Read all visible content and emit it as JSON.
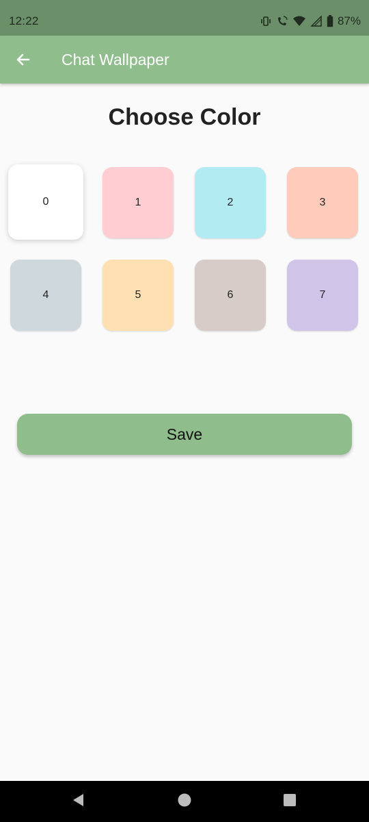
{
  "status_bar": {
    "time": "12:22",
    "battery": "87%",
    "icons": [
      "vibrate-icon",
      "wifi-call-icon",
      "wifi-icon",
      "signal-icon",
      "battery-icon"
    ]
  },
  "app_bar": {
    "title": "Chat Wallpaper",
    "back_icon": "arrow-left-icon",
    "color": "#8fbd8c"
  },
  "page": {
    "title": "Choose Color"
  },
  "swatches": [
    {
      "label": "0",
      "color": "#ffffff",
      "selected": true
    },
    {
      "label": "1",
      "color": "#ffcdd2"
    },
    {
      "label": "2",
      "color": "#b2ebf2"
    },
    {
      "label": "3",
      "color": "#ffccbc"
    },
    {
      "label": "4",
      "color": "#cfd8dc"
    },
    {
      "label": "5",
      "color": "#ffe0b2"
    },
    {
      "label": "6",
      "color": "#d7ccc8"
    },
    {
      "label": "7",
      "color": "#d1c4e9"
    }
  ],
  "actions": {
    "save_label": "Save"
  },
  "nav_bar": {
    "icons": [
      "back-triangle-icon",
      "home-circle-icon",
      "recents-square-icon"
    ]
  }
}
